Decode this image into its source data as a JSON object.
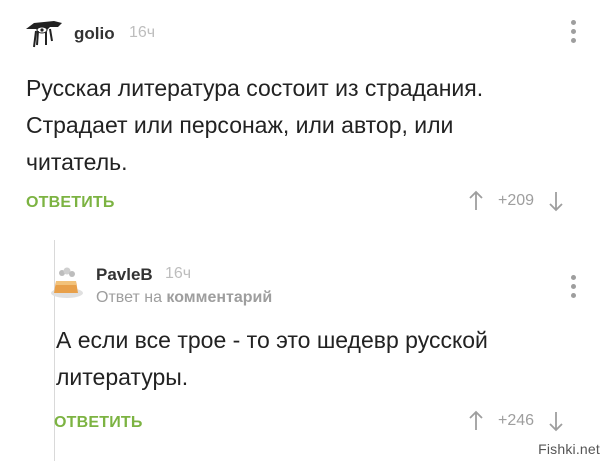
{
  "comments": [
    {
      "username": "golio",
      "time": "16ч",
      "lines": [
        "Русская литература состоит из страдания.",
        "Страдает или персонаж, или автор, или",
        "читатель."
      ],
      "reply_label": "ОТВЕТИТЬ",
      "score": "+209"
    },
    {
      "username": "PavleB",
      "time": "16ч",
      "reply_prefix": "Ответ на",
      "reply_target": "комментарий",
      "lines": [
        "А если все трое - то это шедевр русской",
        "литературы."
      ],
      "reply_label": "ОТВЕТИТЬ",
      "score": "+246"
    }
  ],
  "colors": {
    "accent": "#7cb342",
    "muted": "#9e9e9e",
    "text": "#222222"
  },
  "icons": {
    "upvote": "arrow-up-icon",
    "downvote": "arrow-down-icon",
    "menu": "vertical-dots-icon"
  },
  "watermark": "Fishki.net"
}
